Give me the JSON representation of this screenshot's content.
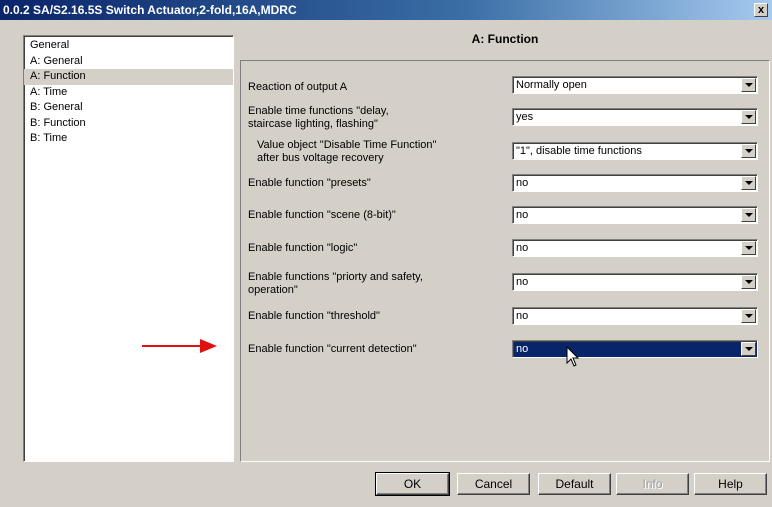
{
  "window": {
    "title": "0.0.2 SA/S2.16.5S Switch Actuator,2-fold,16A,MDRC",
    "close_label": "x"
  },
  "nav": {
    "items": [
      {
        "label": "General"
      },
      {
        "label": "A: General"
      },
      {
        "label": "A: Function",
        "selected": true
      },
      {
        "label": "A: Time"
      },
      {
        "label": "B: General"
      },
      {
        "label": "B: Function"
      },
      {
        "label": "B: Time"
      }
    ]
  },
  "panel": {
    "title": "A: Function",
    "params": [
      {
        "label": "Reaction of output A",
        "value": "Normally open"
      },
      {
        "label": "Enable time functions \"delay, staircase lighting, flashing\"",
        "value": "yes"
      },
      {
        "label": "Value object \"Disable Time Function\" after bus voltage recovery",
        "value": "\"1\", disable time functions"
      },
      {
        "label": "Enable function \"presets\"",
        "value": "no"
      },
      {
        "label": "Enable function \"scene (8-bit)\"",
        "value": "no"
      },
      {
        "label": "Enable function \"logic\"",
        "value": "no"
      },
      {
        "label": "Enable functions \"priorty and safety, operation\"",
        "value": "no"
      },
      {
        "label": "Enable function \"threshold\"",
        "value": "no"
      },
      {
        "label": "Enable function \"current detection\"",
        "value": "no",
        "active": true
      }
    ]
  },
  "buttons": {
    "ok": "OK",
    "cancel": "Cancel",
    "default": "Default",
    "info": "Info",
    "help": "Help"
  },
  "colors": {
    "title_bar": "#0a246a",
    "selection": "#0a246a",
    "annotation_arrow": "#e01010"
  }
}
